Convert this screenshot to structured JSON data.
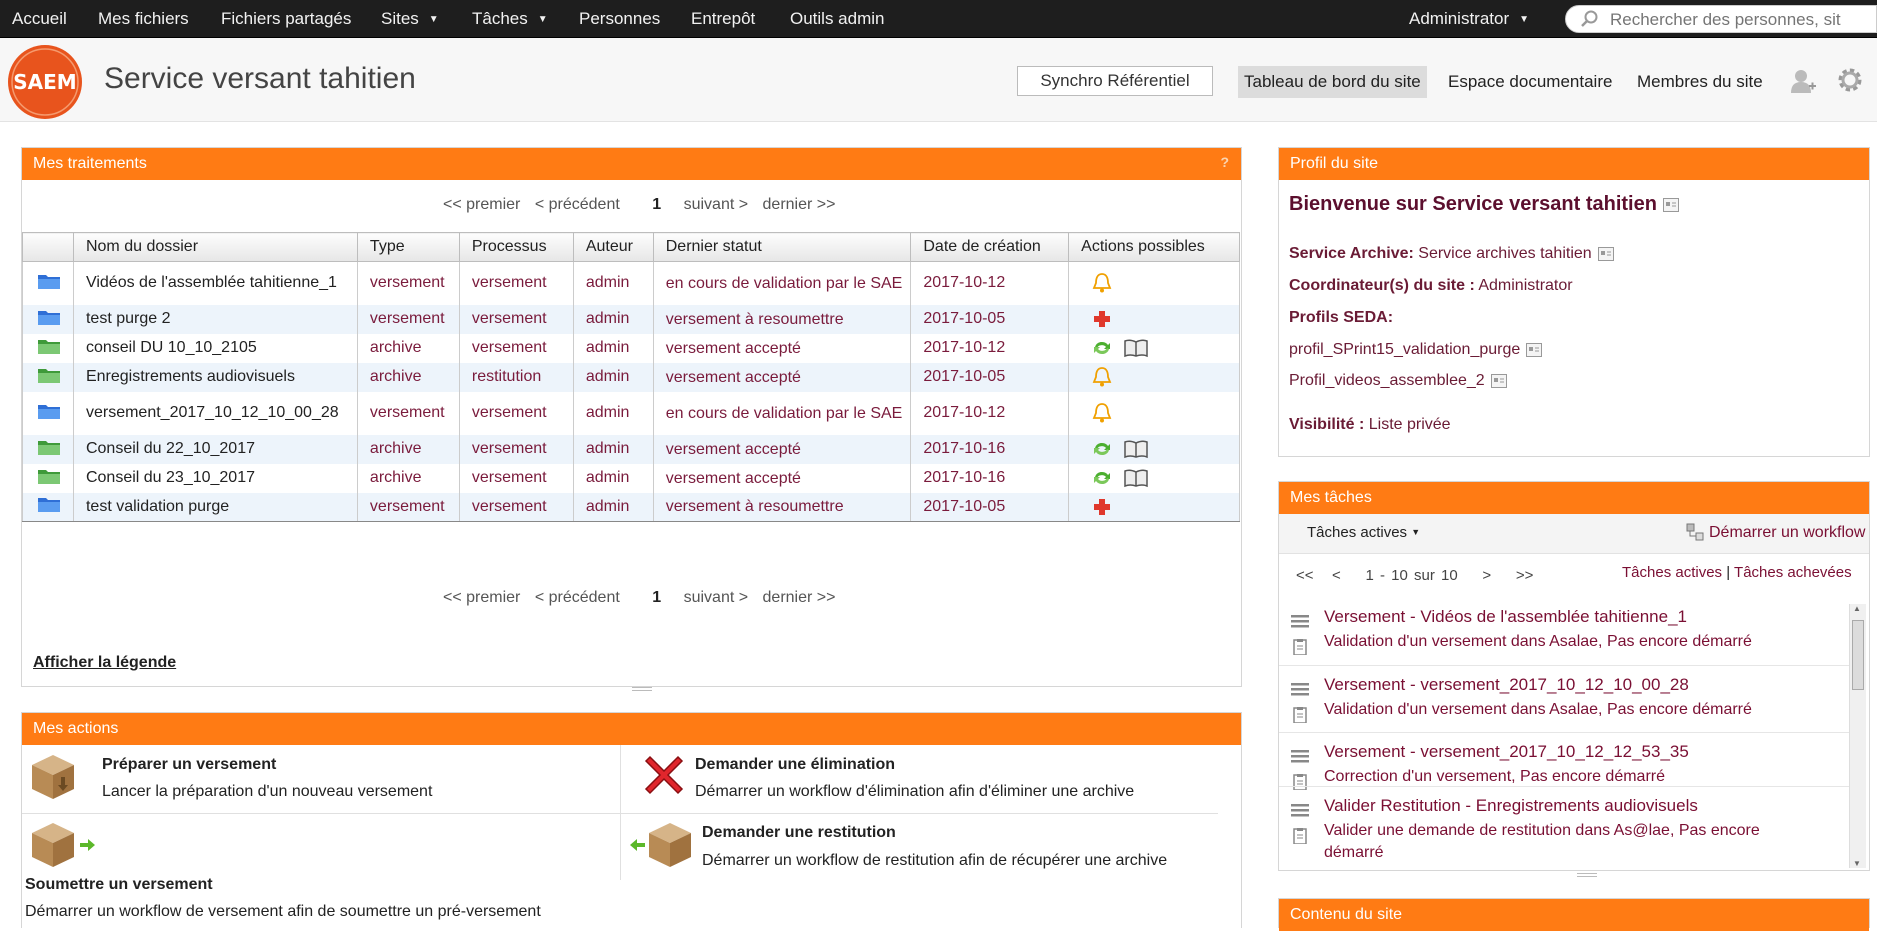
{
  "topnav": {
    "items": [
      {
        "label": "Accueil"
      },
      {
        "label": "Mes fichiers"
      },
      {
        "label": "Fichiers partagés"
      },
      {
        "label": "Sites"
      },
      {
        "label": "Tâches"
      },
      {
        "label": "Personnes"
      },
      {
        "label": "Entrepôt"
      },
      {
        "label": "Outils admin"
      }
    ],
    "user": "Administrator",
    "search_placeholder": "Rechercher des personnes, sit"
  },
  "header": {
    "logo_text": "SAEM",
    "site_title": "Service versant tahitien",
    "synchro_label": "Synchro Référentiel",
    "links": [
      "Tableau de bord du site",
      "Espace documentaire",
      "Membres du site"
    ]
  },
  "traitements": {
    "title": "Mes traitements",
    "help": "?",
    "pager": {
      "first": "<< premier",
      "prev": "< précédent",
      "page": "1",
      "next": "suivant >",
      "last": "dernier >>"
    },
    "columns": [
      "Nom du dossier",
      "Type",
      "Processus",
      "Auteur",
      "Dernier statut",
      "Date de création",
      "Actions possibles"
    ],
    "rows": [
      {
        "icon": "blue-folder-icon",
        "name": "Vidéos de l'assemblée tahitienne_1",
        "type": "versement",
        "process": "versement",
        "author": "admin",
        "status": "en cours de validation par le SAE",
        "date": "2017-10-12",
        "actions": [
          "bell-icon"
        ]
      },
      {
        "icon": "blue-folder-icon",
        "name": "test purge 2",
        "type": "versement",
        "process": "versement",
        "author": "admin",
        "status": "versement à resoumettre",
        "date": "2017-10-05",
        "actions": [
          "red-plus-icon"
        ]
      },
      {
        "icon": "green-folder-icon",
        "name": "conseil DU 10_10_2105",
        "type": "archive",
        "process": "versement",
        "author": "admin",
        "status": "versement accepté",
        "date": "2017-10-12",
        "actions": [
          "refresh-icon",
          "book-icon"
        ]
      },
      {
        "icon": "green-folder-icon",
        "name": "Enregistrements audiovisuels",
        "type": "archive",
        "process": "restitution",
        "author": "admin",
        "status": "versement accepté",
        "date": "2017-10-05",
        "actions": [
          "bell-icon"
        ]
      },
      {
        "icon": "blue-folder-icon",
        "name": "versement_2017_10_12_10_00_28",
        "type": "versement",
        "process": "versement",
        "author": "admin",
        "status": "en cours de validation par le SAE",
        "date": "2017-10-12",
        "actions": [
          "bell-icon"
        ]
      },
      {
        "icon": "green-folder-icon",
        "name": "Conseil du 22_10_2017",
        "type": "archive",
        "process": "versement",
        "author": "admin",
        "status": "versement accepté",
        "date": "2017-10-16",
        "actions": [
          "refresh-icon",
          "book-icon"
        ]
      },
      {
        "icon": "green-folder-icon",
        "name": "Conseil du 23_10_2017",
        "type": "archive",
        "process": "versement",
        "author": "admin",
        "status": "versement accepté",
        "date": "2017-10-16",
        "actions": [
          "refresh-icon",
          "book-icon"
        ]
      },
      {
        "icon": "blue-folder-icon",
        "name": "test validation purge",
        "type": "versement",
        "process": "versement",
        "author": "admin",
        "status": "versement à resoumettre",
        "date": "2017-10-05",
        "actions": [
          "red-plus-icon"
        ]
      }
    ],
    "legend_link": "Afficher la légende"
  },
  "actions": {
    "title": "Mes actions",
    "items": [
      {
        "title": "Préparer un versement",
        "desc": "Lancer la préparation d'un nouveau versement"
      },
      {
        "title": "Demander une élimination",
        "desc": "Démarrer un workflow d'élimination afin d'éliminer une archive"
      },
      {
        "title": "Soumettre un versement",
        "desc": "Démarrer un workflow de versement afin de soumettre un pré-versement"
      },
      {
        "title": "Demander une restitution",
        "desc": "Démarrer un workflow de restitution afin de récupérer une archive"
      }
    ]
  },
  "profile": {
    "title": "Profil du site",
    "welcome": "Bienvenue sur Service versant tahitien",
    "archive_label": "Service Archive:",
    "archive_value": "Service archives tahitien",
    "coord_label": "Coordinateur(s) du site :",
    "coord_value": "Administrator",
    "seda_label": "Profils SEDA:",
    "seda_profiles": [
      "profil_SPrint15_validation_purge",
      "Profil_videos_assemblee_2"
    ],
    "visibility_label": "Visibilité :",
    "visibility_value": "Liste privée"
  },
  "tasks": {
    "title": "Mes tâches",
    "filter": "Tâches actives",
    "start_workflow": "Démarrer un workflow",
    "pager": {
      "first": "<<",
      "prev": "<",
      "range": "1 - 10 sur 10",
      "next": ">",
      "last": ">>"
    },
    "active_link": "Tâches actives",
    "separator": "|",
    "done_link": "Tâches achevées",
    "items": [
      {
        "title": "Versement - Vidéos de l'assemblée tahitienne_1",
        "desc": "Validation d'un versement dans Asalae, Pas encore démarré"
      },
      {
        "title": "Versement - versement_2017_10_12_10_00_28",
        "desc": "Validation d'un versement dans Asalae, Pas encore démarré"
      },
      {
        "title": "Versement - versement_2017_10_12_12_53_35",
        "desc": "Correction d'un versement, Pas encore démarré"
      },
      {
        "title": "Valider Restitution - Enregistrements audiovisuels",
        "desc": "Valider une demande de restitution dans As@lae, Pas encore",
        "desc2": "démarré"
      }
    ]
  },
  "content": {
    "title": "Contenu du site"
  }
}
